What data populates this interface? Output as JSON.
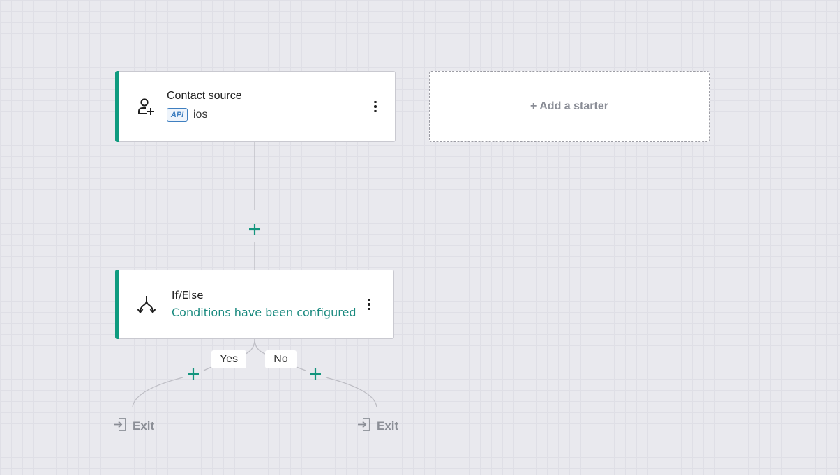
{
  "colors": {
    "accent": "#0f9b7f",
    "plus": "#14957e",
    "condition": "#1a8a7f",
    "muted": "#8b8e96"
  },
  "contact_node": {
    "icon": "user-plus-icon",
    "title": "Contact source",
    "badge": "API",
    "source_value": "ios"
  },
  "ifelse_node": {
    "icon": "split-arrows-icon",
    "title": "If/Else",
    "status": "Conditions have been configured"
  },
  "add_starter": {
    "label": "+ Add a starter"
  },
  "branches": {
    "yes_label": "Yes",
    "no_label": "No"
  },
  "exits": [
    {
      "icon": "exit-icon",
      "label": "Exit"
    },
    {
      "icon": "exit-icon",
      "label": "Exit"
    }
  ]
}
